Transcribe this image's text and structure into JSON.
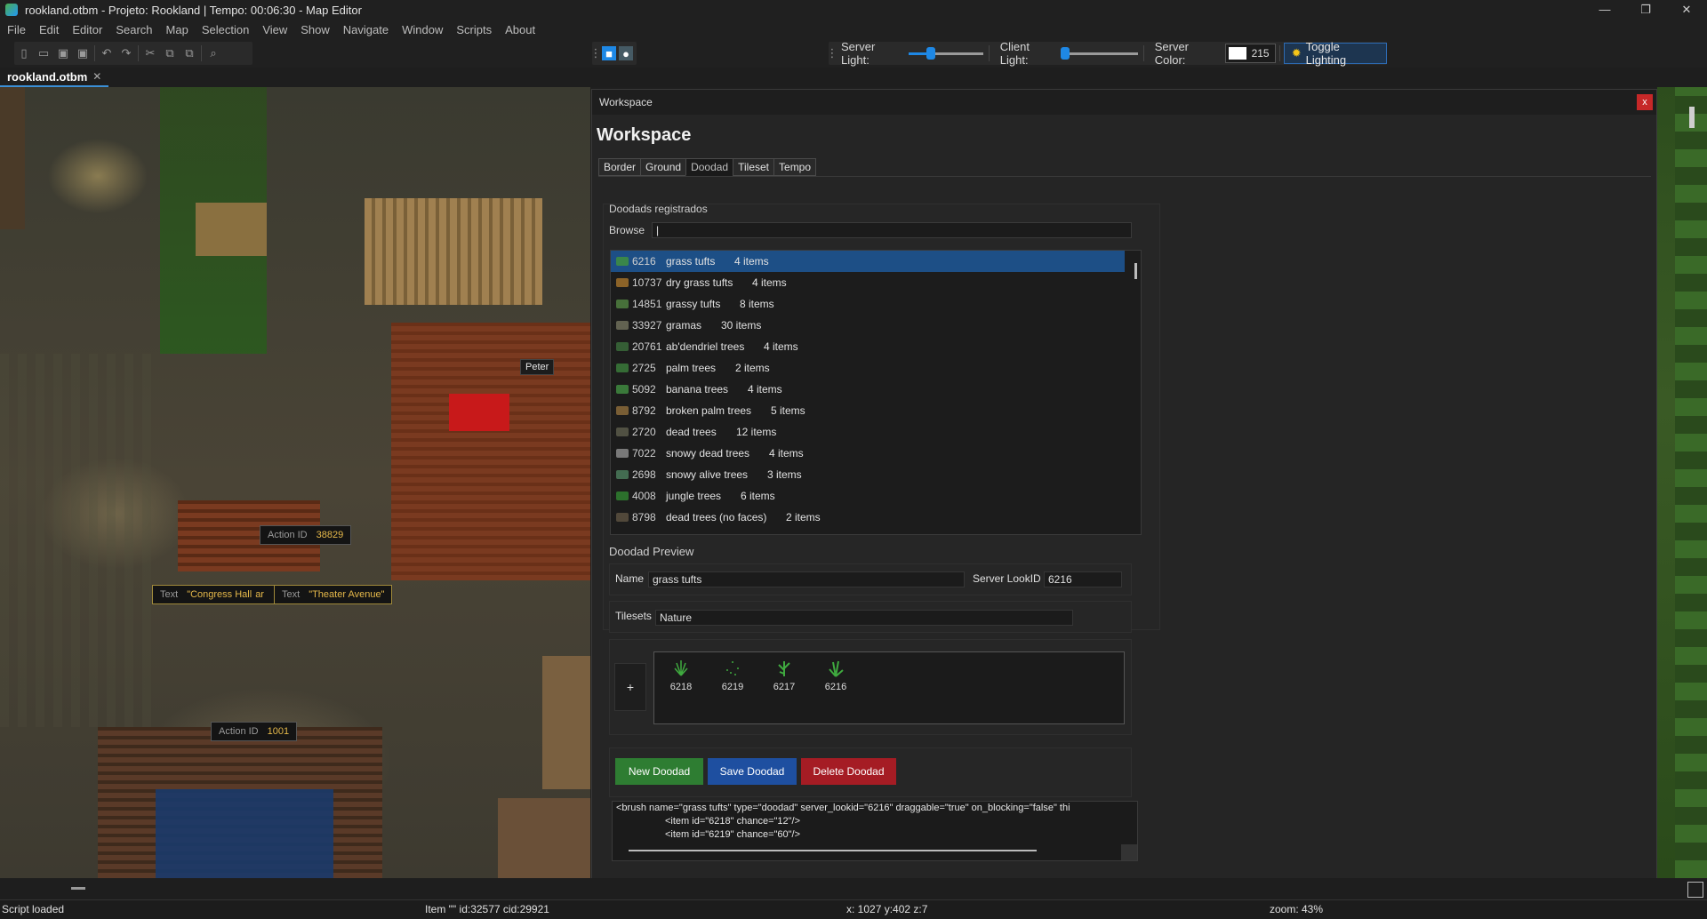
{
  "window": {
    "title": "rookland.otbm - Projeto: Rookland | Tempo: 00:06:30 - Map Editor",
    "controls": [
      "—",
      "❐",
      "✕"
    ]
  },
  "menu": [
    "File",
    "Edit",
    "Editor",
    "Search",
    "Map",
    "Selection",
    "View",
    "Show",
    "Navigate",
    "Window",
    "Scripts",
    "About"
  ],
  "toolbar": {
    "server_light_label": "Server Light:",
    "server_light_value": 0.3,
    "client_light_label": "Client Light:",
    "client_light_value": 0.02,
    "server_color_label": "Server Color:",
    "server_color_value": "215",
    "toggle_lighting_label": "Toggle Lighting"
  },
  "file_tab": {
    "name": "rookland.otbm",
    "close": "✕"
  },
  "map_labels": {
    "npc_peter": "Peter",
    "action1_key": "Action ID",
    "action1_value": "38829",
    "text1_key": "Text",
    "text1_value": "\"Congress Hall",
    "text1_suffix": "ar",
    "text2_key": "Text",
    "text2_value": "\"Theater Avenue\"",
    "action2_key": "Action ID",
    "action2_value": "1001"
  },
  "workspace": {
    "header": "Workspace",
    "close": "x",
    "title": "Workspace",
    "tabs": [
      "Border",
      "Ground",
      "Doodad",
      "Tileset",
      "Tempo"
    ],
    "active_tab": "Doodad",
    "registered_title": "Doodads registrados",
    "browse_label": "Browse",
    "browse_value": "|",
    "list": [
      {
        "id": "6216",
        "name": "grass tufts",
        "count": "4 items",
        "color": "#3f8f3f"
      },
      {
        "id": "10737",
        "name": "dry grass tufts",
        "count": "4 items",
        "color": "#a0702a"
      },
      {
        "id": "14851",
        "name": "grassy tufts",
        "count": "8 items",
        "color": "#4f7f3f"
      },
      {
        "id": "33927",
        "name": "gramas",
        "count": "30 items",
        "color": "#6f6f5a"
      },
      {
        "id": "20761",
        "name": "ab'dendriel trees",
        "count": "4 items",
        "color": "#3a6a3a"
      },
      {
        "id": "2725",
        "name": "palm trees",
        "count": "2 items",
        "color": "#3a7a3a"
      },
      {
        "id": "5092",
        "name": "banana trees",
        "count": "4 items",
        "color": "#3f8a3f"
      },
      {
        "id": "8792",
        "name": "broken palm trees",
        "count": "5 items",
        "color": "#8a6a3a"
      },
      {
        "id": "2720",
        "name": "dead trees",
        "count": "12 items",
        "color": "#5a5a4a"
      },
      {
        "id": "7022",
        "name": "snowy dead trees",
        "count": "4 items",
        "color": "#8a8a8a"
      },
      {
        "id": "2698",
        "name": "snowy alive trees",
        "count": "3 items",
        "color": "#4a7a5a"
      },
      {
        "id": "4008",
        "name": "jungle trees",
        "count": "6 items",
        "color": "#2f7f2f"
      },
      {
        "id": "8798",
        "name": "dead trees (no faces)",
        "count": "2 items",
        "color": "#5a5040"
      }
    ],
    "preview_title": "Doodad Preview",
    "name_label": "Name",
    "name_value": "grass tufts",
    "lookid_label": "Server LookID",
    "lookid_value": "6216",
    "tilesets_label": "Tilesets",
    "tilesets_value": "Nature",
    "add_label": "+",
    "items": [
      {
        "id": "6218"
      },
      {
        "id": "6219"
      },
      {
        "id": "6217"
      },
      {
        "id": "6216"
      }
    ],
    "buttons": {
      "new": "New Doodad",
      "new_color": "#2e7d32",
      "save": "Save Doodad",
      "save_color": "#1e4fa0",
      "delete": "Delete Doodad",
      "delete_color": "#a51c24"
    },
    "xml_lines": [
      "<brush name=\"grass tufts\" type=\"doodad\" server_lookid=\"6216\" draggable=\"true\" on_blocking=\"false\" thi",
      "                  <item id=\"6218\" chance=\"12\"/>",
      "                  <item id=\"6219\" chance=\"60\"/>"
    ]
  },
  "status": {
    "message": "Script loaded",
    "item": "Item \"\" id:32577 cid:29921",
    "coords": "x: 1027 y:402 z:7",
    "zoom": "zoom: 43%"
  }
}
